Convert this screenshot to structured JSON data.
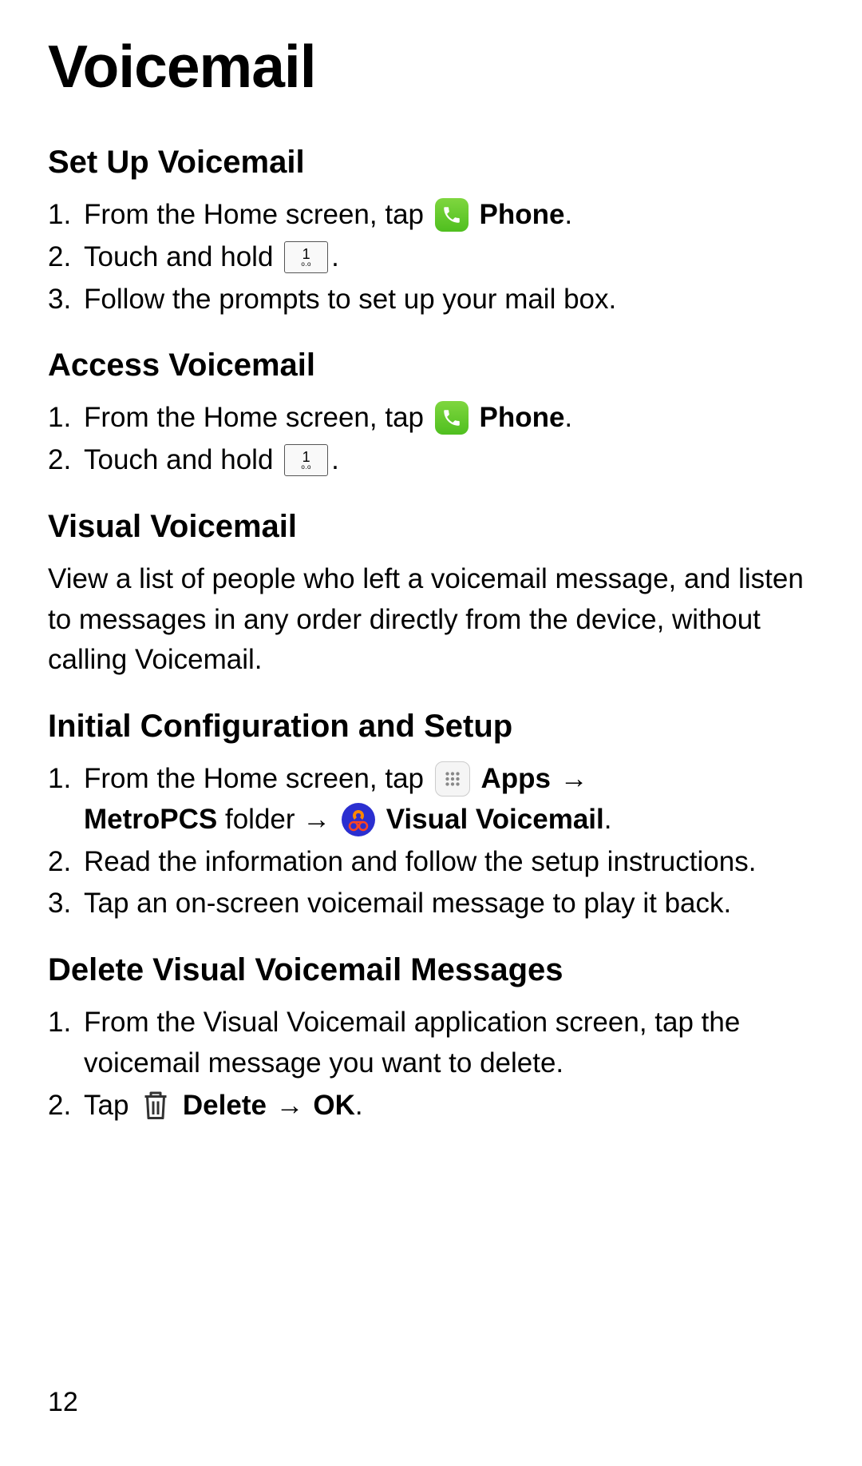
{
  "title": "Voicemail",
  "page_number": "12",
  "sections": {
    "setup": {
      "heading": "Set Up Voicemail",
      "step1_a": "From the Home screen, tap ",
      "step1_b": "Phone",
      "step1_c": ".",
      "step2_a": "Touch and hold ",
      "step2_b": ".",
      "step3": "Follow the prompts to set up your mail box."
    },
    "access": {
      "heading": "Access Voicemail",
      "step1_a": "From the Home screen, tap ",
      "step1_b": "Phone",
      "step1_c": ".",
      "step2_a": "Touch and hold ",
      "step2_b": "."
    },
    "visual": {
      "heading": "Visual Voicemail",
      "body": "View a list of people who left a voicemail message, and listen to messages in any order directly from the device, without calling Voicemail."
    },
    "config": {
      "heading": "Initial Configuration and Setup",
      "step1_a": "From the Home screen, tap ",
      "step1_b": "Apps",
      "step1_arrow": " → ",
      "step1_c": "MetroPCS",
      "step1_d": " folder → ",
      "step1_e": "Visual Voicemail",
      "step1_f": ".",
      "step2": "Read the information and follow the setup instructions.",
      "step3": "Tap an on-screen voicemail message to play it back."
    },
    "delete": {
      "heading": "Delete Visual Voicemail Messages",
      "step1": "From the Visual Voicemail application screen, tap the voicemail message you want to delete.",
      "step2_a": "Tap ",
      "step2_b": "Delete",
      "step2_arrow": " → ",
      "step2_c": "OK",
      "step2_d": "."
    }
  },
  "icons": {
    "key1_num": "1",
    "key1_sub": "o.o"
  }
}
